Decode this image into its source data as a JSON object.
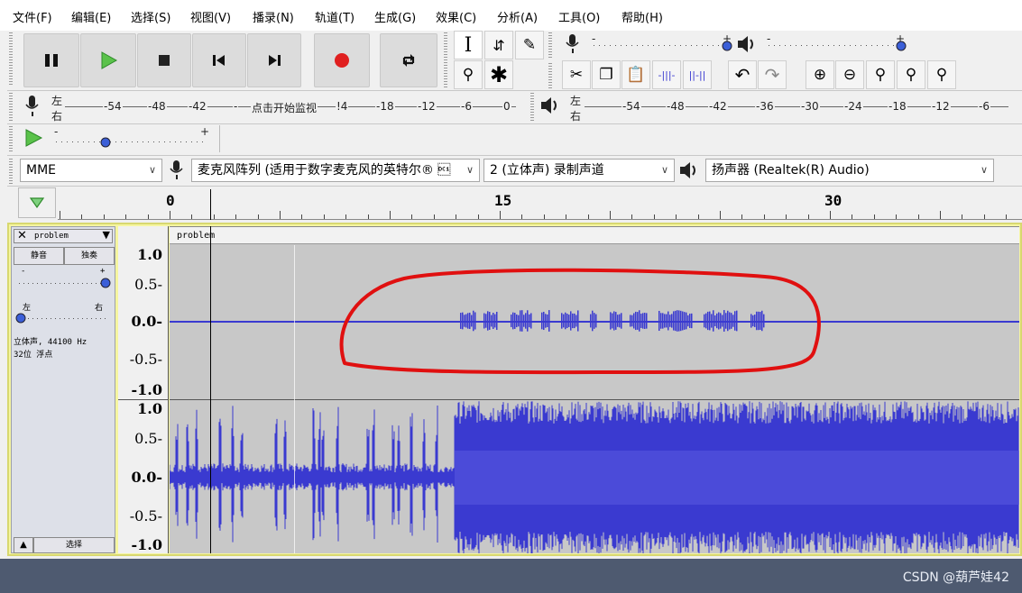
{
  "menu": [
    "文件(F)",
    "编辑(E)",
    "选择(S)",
    "视图(V)",
    "播录(N)",
    "轨道(T)",
    "生成(G)",
    "效果(C)",
    "分析(A)",
    "工具(O)",
    "帮助(H)"
  ],
  "transport": {
    "pause": "pause",
    "play": "play",
    "stop": "stop",
    "skip_start": "skip-start",
    "skip_end": "skip-end",
    "record": "record",
    "loop": "loop"
  },
  "tools_row1": [
    "I",
    "✱",
    "✎"
  ],
  "tools_row2": [
    "🔍",
    "✳"
  ],
  "edit_tools": [
    "✂",
    "❐",
    "📋",
    "⊣⊢",
    "⊢⊣",
    "↶",
    "↷",
    "⊕",
    "⊖",
    "⌕",
    "⌕",
    "⌕"
  ],
  "rec_meter": {
    "left": "左",
    "right": "右",
    "ticks": [
      "-54",
      "-48",
      "-42",
      "-",
      "点击开始监视",
      "!4",
      "-18",
      "-12",
      "-6",
      "0"
    ]
  },
  "play_meter": {
    "left": "左",
    "right": "右",
    "ticks": [
      "-54",
      "-48",
      "-42",
      "-36",
      "-30",
      "-24",
      "-18",
      "-12",
      "-6"
    ]
  },
  "device": {
    "host": "MME",
    "input": "麦克风阵列 (适用于数字麦克风的英特尔® \u0011",
    "channels": "2 (立体声) 录制声道",
    "output": "扬声器 (Realtek(R) Audio)"
  },
  "timeline": {
    "marks": [
      "0",
      "15",
      "30"
    ]
  },
  "track": {
    "name": "problem",
    "clip_name": "problem",
    "mute": "静音",
    "solo": "独奏",
    "gain_minus": "-",
    "gain_plus": "+",
    "pan_left": "左",
    "pan_right": "右",
    "info_line1": "立体声, 44100 Hz",
    "info_line2": "32位 浮点",
    "select": "选择"
  },
  "vruler_labels": [
    "1.0",
    "0.5-",
    "0.0-",
    "-0.5-",
    "-1.0"
  ],
  "watermark": "CSDN @葫芦娃42",
  "colors": {
    "wave": "#3a3ad0",
    "wave_loud": "#5a5ae0",
    "annot": "#e01010",
    "record": "#e02020",
    "play": "#3caa3c"
  }
}
